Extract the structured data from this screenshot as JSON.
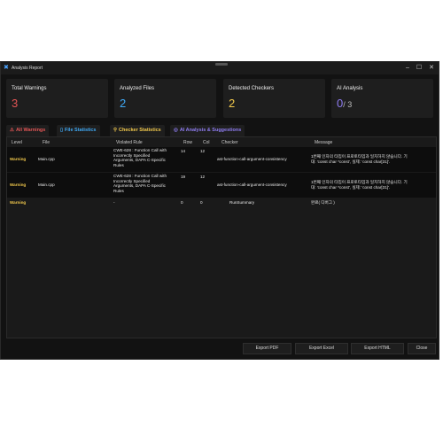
{
  "window": {
    "title": "Analysis Report"
  },
  "stats": [
    {
      "label": "Total Warnings",
      "value": "3",
      "color": "#e25555"
    },
    {
      "label": "Analyzed Files",
      "value": "2",
      "color": "#3fa9f5"
    },
    {
      "label": "Detected Checkers",
      "value": "2",
      "color": "#f2c94c"
    },
    {
      "label": "AI Analysis",
      "value": "0",
      "value_suffix": "/ 3",
      "color": "#8e7cf0"
    }
  ],
  "tabs": [
    {
      "label": "All Warnings",
      "icon": "warning-icon",
      "color": "#e25555"
    },
    {
      "label": "File Statistics",
      "icon": "file-icon",
      "color": "#3fa9f5"
    },
    {
      "label": "Checker Statistics",
      "icon": "search-icon",
      "color": "#f2c94c"
    },
    {
      "label": "AI Analysis & Suggestions",
      "icon": "ai-icon",
      "color": "#8e7cf0"
    }
  ],
  "table": {
    "headers": {
      "level": "Level",
      "file": "File",
      "rule": "Violated Rule",
      "row": "Row",
      "col": "Col",
      "checker": "Checker",
      "message": "Message"
    },
    "rows": [
      {
        "level": "Warning",
        "file": "Main.cpp",
        "rule": [
          "CWE-628 : Function Call with",
          "Incorrectly Specified",
          "Arguments, DAPA C-Specific",
          "Rules"
        ],
        "row": "14",
        "col": "12",
        "checker": "ast-function-call-argument-consistency",
        "message": [
          "1번째 인자의 타입이 프로토타입과 일치하지 않습니다. 기",
          "대: 'const char *const', 실제: 'const char[31]'."
        ]
      },
      {
        "level": "Warning",
        "file": "Main.cpp",
        "rule": [
          "CWE-628 : Function Call with",
          "Incorrectly Specified",
          "Arguments, DAPA C-Specific",
          "Rules"
        ],
        "row": "19",
        "col": "12",
        "checker": "ast-function-call-argument-consistency",
        "message": [
          "1번째 인자의 타입이 프로토타입과 일치하지 않습니다. 기",
          "대: 'const char *const', 실제: 'const char[31]'."
        ]
      },
      {
        "level": "Warning",
        "file": "",
        "rule": [
          "-"
        ],
        "row": "0",
        "col": "0",
        "checker": "RunSummary",
        "message": [
          "완료( 디버그 )"
        ]
      }
    ]
  },
  "footer": {
    "export_pdf": "Export PDF",
    "export_excel": "Export Excel",
    "export_html": "Export HTML",
    "close": "Close"
  }
}
